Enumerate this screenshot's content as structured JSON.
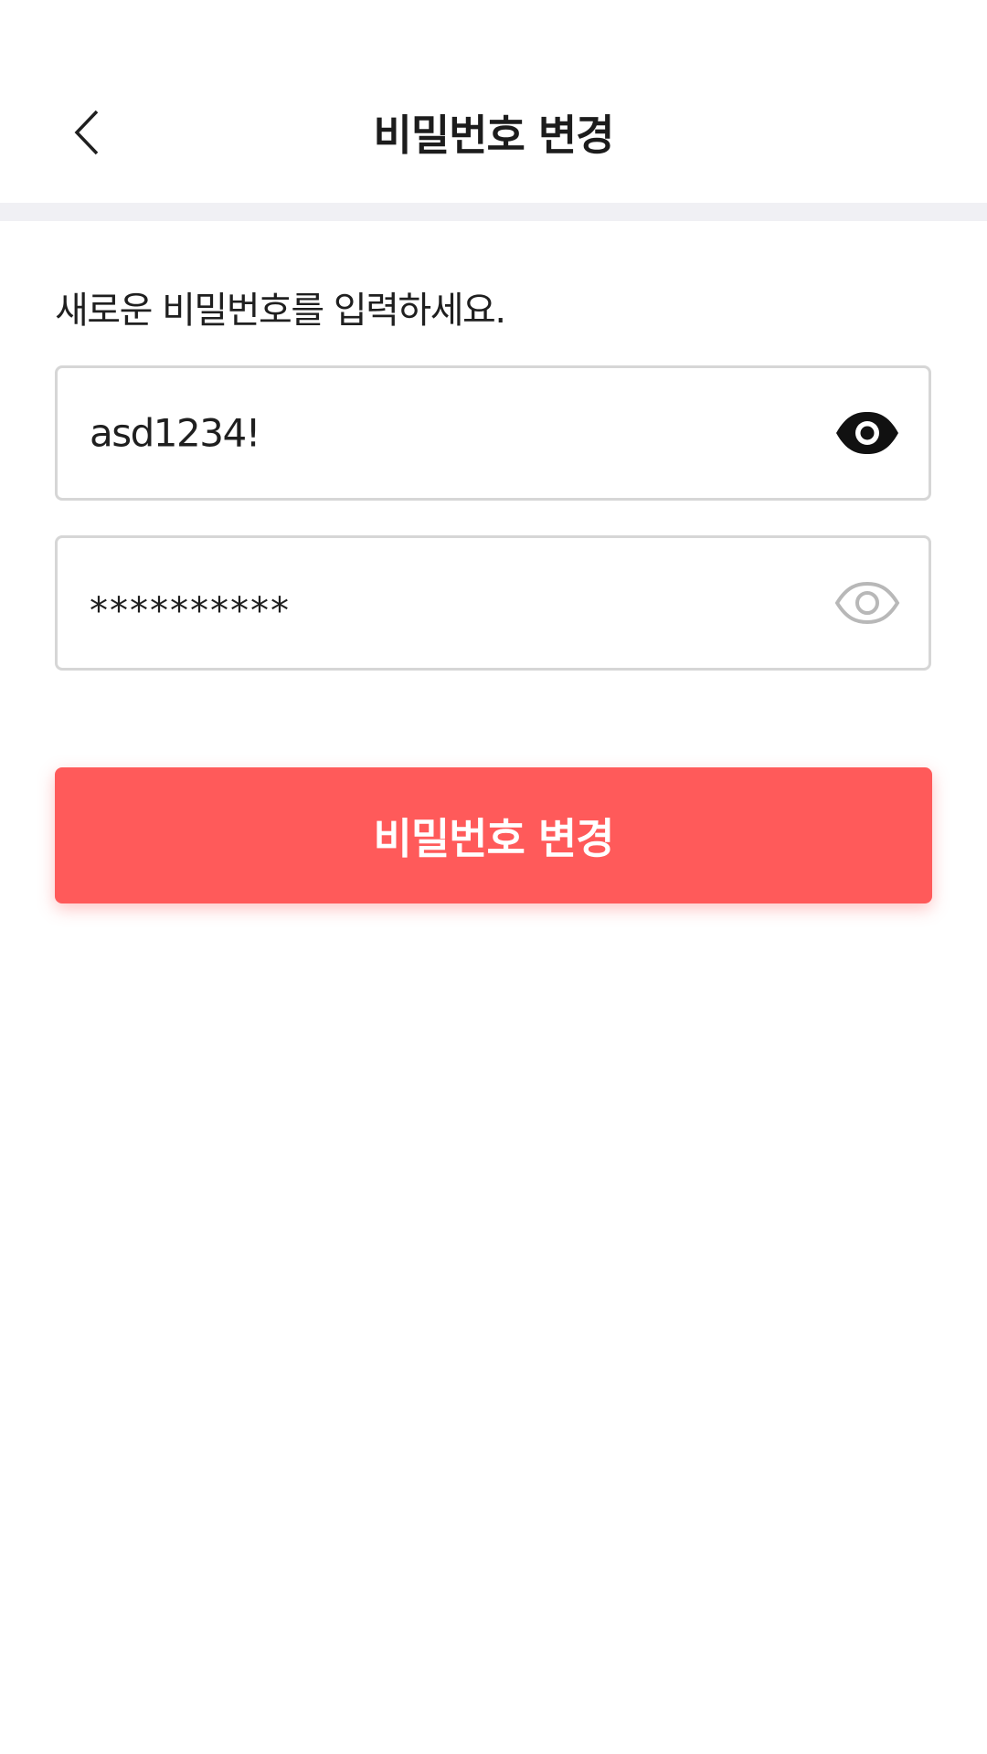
{
  "header": {
    "title": "비밀번호 변경",
    "back_icon": "chevron-left-icon"
  },
  "form": {
    "instruction": "새로운 비밀번호를 입력하세요.",
    "new_password": {
      "value": "asd1234!",
      "visibility_icon": "eye-icon",
      "visible": true
    },
    "confirm_password": {
      "value": "**********",
      "visibility_icon": "eye-icon",
      "visible": false
    },
    "submit_label": "비밀번호 변경"
  },
  "colors": {
    "accent": "#ff5a5a",
    "divider": "#f0f0f4",
    "field_border": "#d6d6d6",
    "eye_active": "#111111",
    "eye_inactive": "#b8b8b8"
  }
}
